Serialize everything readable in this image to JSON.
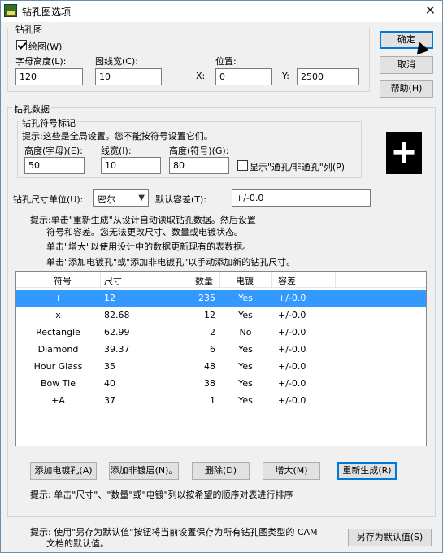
{
  "window": {
    "title": "钻孔图选项",
    "close_glyph": "✕"
  },
  "drill_drawing": {
    "group_label": "钻孔图",
    "draw_checkbox_label": "绘图(W)",
    "draw_checked": true,
    "char_height_label": "字母高度(L):",
    "char_height_value": "120",
    "line_width_label": "图线宽(C):",
    "line_width_value": "10",
    "position_label": "位置:",
    "x_label": "X:",
    "x_value": "0",
    "y_label": "Y:",
    "y_value": "2500"
  },
  "side_buttons": {
    "ok": "确定",
    "cancel": "取消",
    "help": "帮助(H)"
  },
  "drill_data": {
    "group_label": "钻孔数据",
    "symbol_group_label": "钻孔符号标记",
    "hint_global": "提示:这些是全局设置。您不能按符号设置它们。",
    "height_char_label": "高度(字母)(E):",
    "height_char_value": "50",
    "line_width_label": "线宽(I):",
    "line_width_value": "10",
    "height_symbol_label": "高度(符号)(G):",
    "height_symbol_value": "80",
    "show_plated_label": "显示\"通孔/非通孔\"列(P)",
    "show_plated_checked": false,
    "preview_symbol": "+"
  },
  "units": {
    "label": "钻孔尺寸单位(U):",
    "selected": "密尔",
    "tolerance_label": "默认容差(T):",
    "tolerance_value": "+/-0.0"
  },
  "hints": {
    "regen_line1": "提示:单击\"重新生成\"从设计自动读取钻孔数据。然后设置",
    "regen_line2": "符号和容差。您无法更改尺寸、数量或电镀状态。",
    "augment": "单击\"增大\"以使用设计中的数据更新现有的表数据。",
    "add": "单击\"添加电镀孔\"或\"添加非电镀孔\"以手动添加新的钻孔尺寸。",
    "sort": "提示: 单击\"尺寸\"、\"数量\"或\"电镀\"列以按希望的顺序对表进行排序",
    "save_default_line1": "提示: 使用\"另存为默认值\"按钮将当前设置保存为所有钻孔图类型的 CAM",
    "save_default_line2": "文档的默认值。"
  },
  "table": {
    "headers": [
      "符号",
      "尺寸",
      "数量",
      "电镀",
      "容差"
    ],
    "rows": [
      [
        "+",
        "12",
        "235",
        "Yes",
        "+/-0.0"
      ],
      [
        "x",
        "82.68",
        "12",
        "Yes",
        "+/-0.0"
      ],
      [
        "Rectangle",
        "62.99",
        "2",
        "No",
        "+/-0.0"
      ],
      [
        "Diamond",
        "39.37",
        "6",
        "Yes",
        "+/-0.0"
      ],
      [
        "Hour Glass",
        "35",
        "48",
        "Yes",
        "+/-0.0"
      ],
      [
        "Bow Tie",
        "40",
        "38",
        "Yes",
        "+/-0.0"
      ],
      [
        "+A",
        "37",
        "1",
        "Yes",
        "+/-0.0"
      ]
    ],
    "selected_row": 0
  },
  "action_buttons": {
    "add_plated": "添加电镀孔(A)",
    "add_nonplated": "添加非镀层(N)。",
    "delete": "删除(D)",
    "augment": "增大(M)",
    "regenerate": "重新生成(R)"
  },
  "save_default_button": "另存为默认值(S)"
}
